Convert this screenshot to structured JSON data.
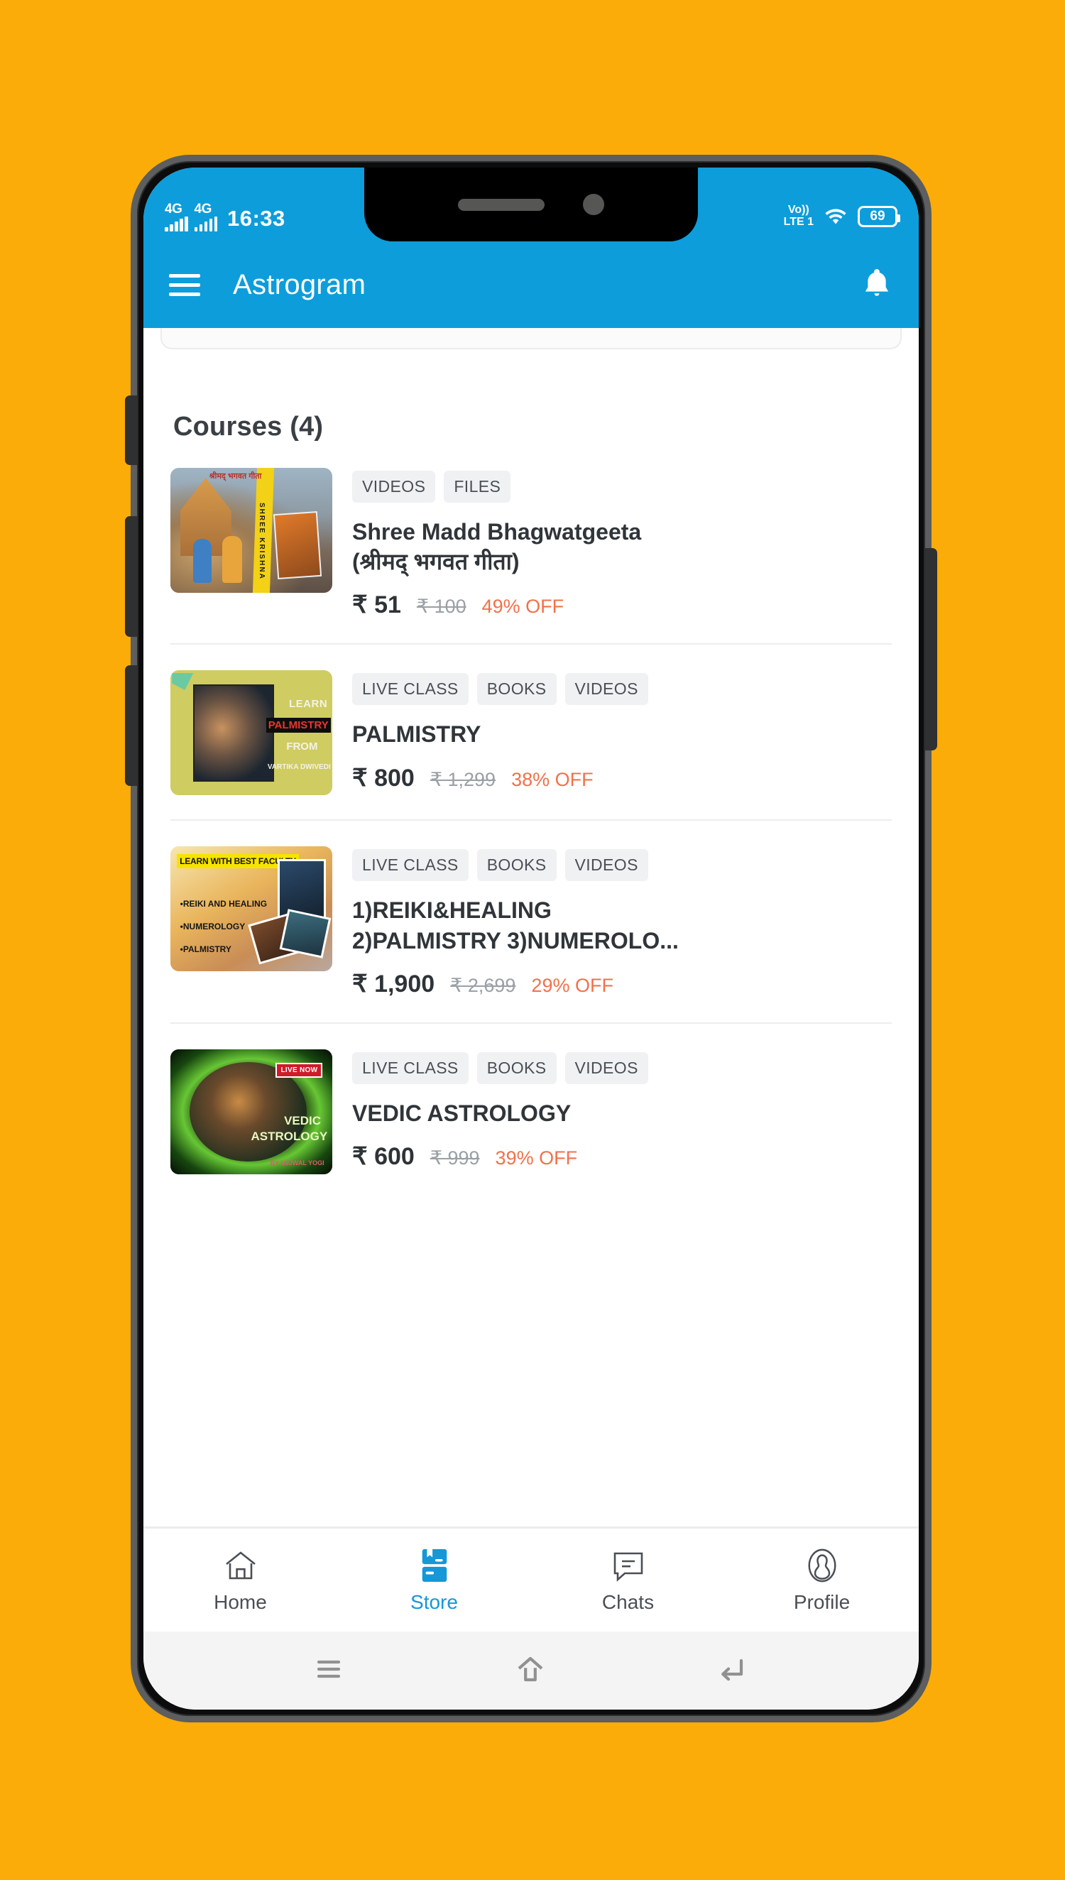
{
  "statusbar": {
    "network_1": "4G",
    "network_2": "4G",
    "time": "16:33",
    "volte_top": "Vo))",
    "volte_bottom": "LTE 1",
    "wifi_icon": "wifi-icon",
    "battery_level": "69"
  },
  "appbar": {
    "menu_icon": "hamburger-menu-icon",
    "title": "Astrogram",
    "notification_icon": "bell-icon"
  },
  "main": {
    "section_title": "Courses (4)",
    "courses": [
      {
        "tags": [
          "VIDEOS",
          "FILES"
        ],
        "title": "Shree Madd Bhagwatgeeta\n(श्रीमद् भगवत गीता)",
        "price": "₹ 51",
        "mrp": "₹ 100",
        "discount": "49% OFF",
        "thumbnail": "shree-krishna-bhagwatgeeta-thumbnail",
        "thumb_text_hindi": "श्रीमद् भगवत गीता",
        "thumb_text_band": "SHREE KRISHNA"
      },
      {
        "tags": [
          "LIVE CLASS",
          "BOOKS",
          "VIDEOS"
        ],
        "title": "PALMISTRY",
        "price": "₹ 800",
        "mrp": "₹ 1,299",
        "discount": "38% OFF",
        "thumbnail": "palmistry-course-thumbnail",
        "thumb_line_1": "LEARN",
        "thumb_line_2": "PALMISTRY",
        "thumb_line_3": "FROM",
        "thumb_line_4": "VARTIKA DWIVEDI"
      },
      {
        "tags": [
          "LIVE CLASS",
          "BOOKS",
          "VIDEOS"
        ],
        "title": "1)REIKI&HEALING\n2)PALMISTRY 3)NUMEROLO...",
        "price": "₹ 1,900",
        "mrp": "₹ 2,699",
        "discount": "29% OFF",
        "thumbnail": "reiki-numerology-palmistry-thumbnail",
        "thumb_banner": "LEARN WITH BEST FACULTY",
        "thumb_bullet_1": "•REIKI AND HEALING",
        "thumb_bullet_2": "•NUMEROLOGY",
        "thumb_bullet_3": "•PALMISTRY"
      },
      {
        "tags": [
          "LIVE CLASS",
          "BOOKS",
          "VIDEOS"
        ],
        "title": "VEDIC ASTROLOGY",
        "price": "₹ 600",
        "mrp": "₹ 999",
        "discount": "39% OFF",
        "thumbnail": "vedic-astrology-thumbnail",
        "thumb_badge": "LIVE NOW",
        "thumb_line_1": "VEDIC",
        "thumb_line_2": "ASTROLOGY",
        "thumb_line_3": "BY UJJWAL YOGI"
      }
    ]
  },
  "bottomnav": {
    "items": [
      {
        "label": "Home",
        "icon": "home-icon",
        "active": false
      },
      {
        "label": "Store",
        "icon": "store-icon",
        "active": true
      },
      {
        "label": "Chats",
        "icon": "chat-icon",
        "active": false
      },
      {
        "label": "Profile",
        "icon": "profile-icon",
        "active": false
      }
    ]
  },
  "sysbar": {
    "recents_icon": "recents-icon",
    "home_icon": "android-home-icon",
    "back_icon": "android-back-icon"
  },
  "colors": {
    "page_background": "#FCAC08",
    "accent_blue": "#0d9ddb",
    "discount_orange": "#f2714a",
    "chip_background": "#f0f1f3"
  }
}
